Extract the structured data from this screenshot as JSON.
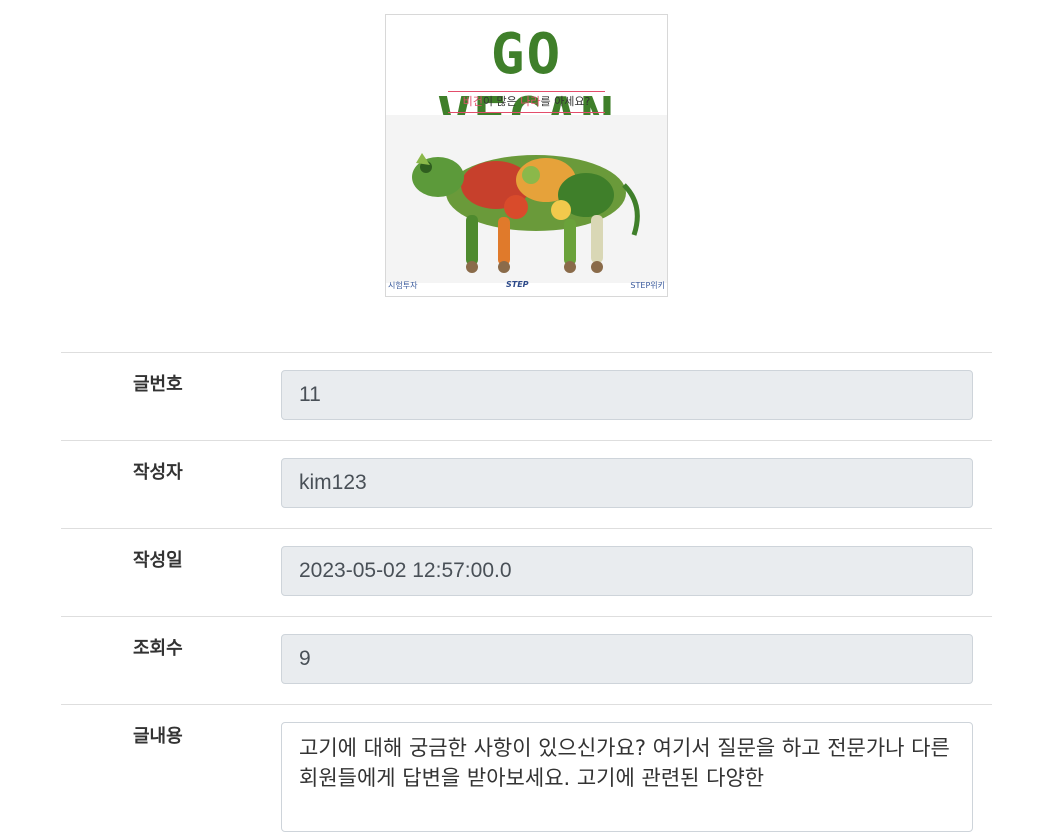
{
  "banner": {
    "title": "GO VEGAN",
    "subtitle_hl1": "비건",
    "subtitle_mid": "이 많은 ",
    "subtitle_hl2": "나라",
    "subtitle_end": "를 아세요?",
    "footer_left": "시험투자",
    "footer_mid": "STEP",
    "footer_right": "STEP위키",
    "colors": {
      "title": "#3f7f2a",
      "highlight": "#e34d6b"
    }
  },
  "form": {
    "rows": [
      {
        "label": "글번호",
        "value": "11"
      },
      {
        "label": "작성자",
        "value": "kim123"
      },
      {
        "label": "작성일",
        "value": "2023-05-02 12:57:00.0"
      },
      {
        "label": "조회수",
        "value": "9"
      }
    ],
    "content": {
      "label": "글내용",
      "value": "고기에 대해 궁금한 사항이 있으신가요? 여기서 질문을 하고 전문가나 다른 회원들에게 답변을 받아보세요. 고기에 관련된 다양한"
    }
  }
}
